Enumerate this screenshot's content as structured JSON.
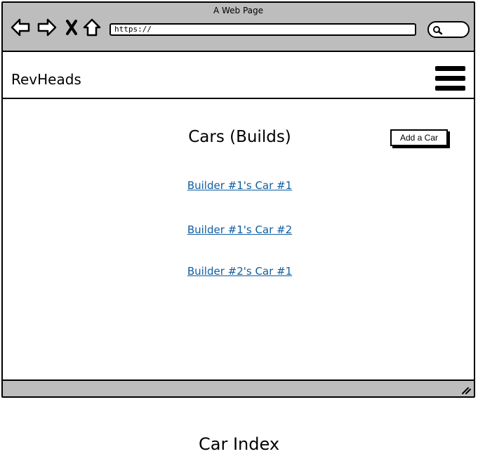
{
  "window": {
    "title": "A Web Page"
  },
  "browser": {
    "url": "https://",
    "icons": [
      "back-arrow-icon",
      "forward-arrow-icon",
      "close-x-icon",
      "home-icon",
      "search-icon"
    ]
  },
  "navbar": {
    "brand": "RevHeads",
    "menu_icon": "hamburger-menu-icon"
  },
  "main": {
    "title": "Cars (Builds)",
    "add_button_label": "Add a Car",
    "cars": [
      {
        "label": "Builder #1's Car #1"
      },
      {
        "label": "Builder #1's Car #2"
      },
      {
        "label": "Builder #2's Car #1"
      }
    ]
  },
  "caption": "Car Index",
  "colors": {
    "chrome": "#bdbdbd",
    "link": "#0f5ea0"
  }
}
